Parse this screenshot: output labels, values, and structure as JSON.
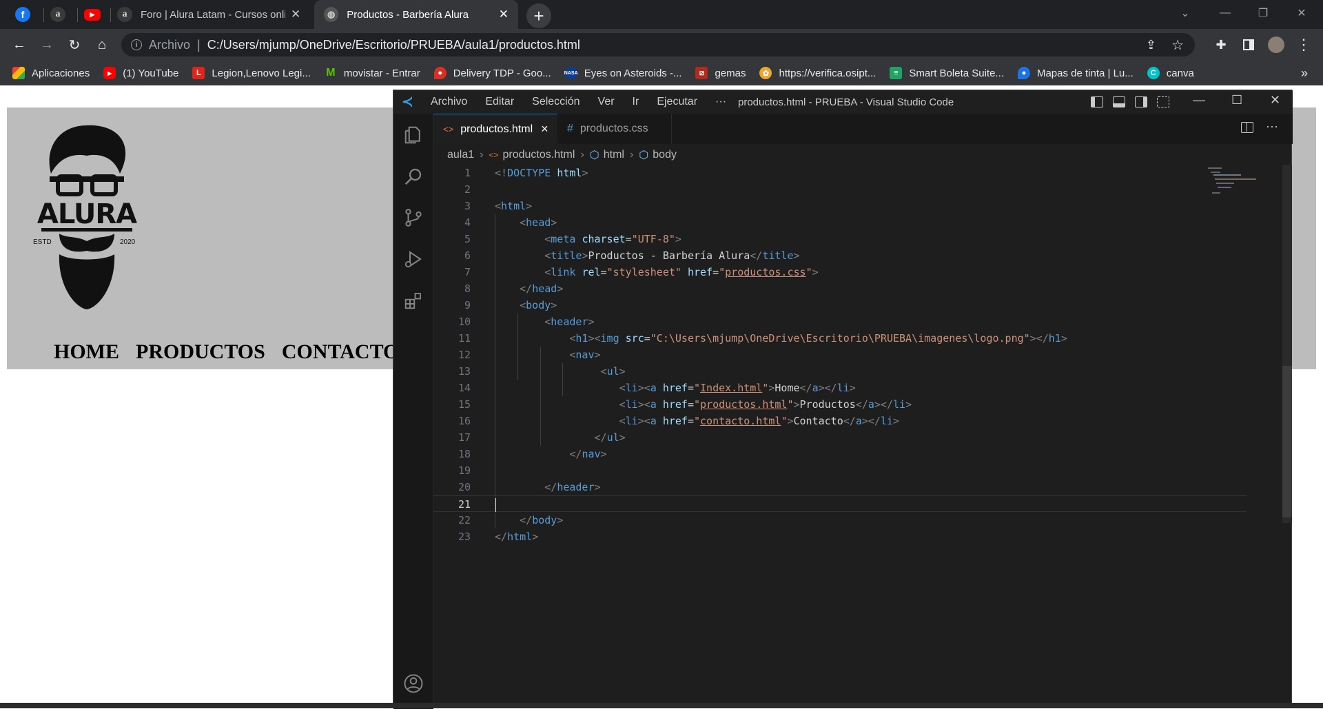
{
  "browser": {
    "tabs": [
      {
        "title": "",
        "icon": "facebook-icon"
      },
      {
        "title": "",
        "icon": "alura-icon"
      },
      {
        "title": "",
        "icon": "youtube-icon"
      },
      {
        "title": "Foro | Alura Latam - Cursos online",
        "icon": "alura-icon"
      },
      {
        "title": "Productos - Barbería Alura",
        "icon": "globe-icon",
        "active": true
      }
    ],
    "address": {
      "label": "Archivo",
      "url": "C:/Users/mjump/OneDrive/Escritorio/PRUEBA/aula1/productos.html"
    },
    "bookmarks": [
      {
        "label": "Aplicaciones",
        "icon": "apps-grid-icon"
      },
      {
        "label": "(1) YouTube",
        "icon": "youtube-icon"
      },
      {
        "label": "Legion,Lenovo Legi...",
        "icon": "lenovo-icon"
      },
      {
        "label": "movistar - Entrar",
        "icon": "movistar-icon"
      },
      {
        "label": "Delivery TDP - Goo...",
        "icon": "maps-pin-icon"
      },
      {
        "label": "Eyes on Asteroids -...",
        "icon": "nasa-icon"
      },
      {
        "label": "gemas",
        "icon": "dota-icon"
      },
      {
        "label": "https://verifica.osipt...",
        "icon": "osiptel-icon"
      },
      {
        "label": "Smart Boleta Suite...",
        "icon": "receipt-icon"
      },
      {
        "label": "Mapas de tinta | Lu...",
        "icon": "map-pin-icon"
      },
      {
        "label": "canva",
        "icon": "canva-icon"
      }
    ],
    "more_bookmarks": "»"
  },
  "site": {
    "logo": {
      "brand": "ALURA",
      "left": "ESTD",
      "right": "2020"
    },
    "nav": [
      "HOME",
      "PRODUCTOS",
      "CONTACTO"
    ]
  },
  "vscode": {
    "menu": [
      "Archivo",
      "Editar",
      "Selección",
      "Ver",
      "Ir",
      "Ejecutar",
      "···"
    ],
    "window_title": "productos.html - PRUEBA - Visual Studio Code",
    "tabs": [
      {
        "name": "productos.html",
        "icon": "<>",
        "active": true,
        "close": "×"
      },
      {
        "name": "productos.css",
        "icon": "#",
        "active": false
      }
    ],
    "breadcrumb": [
      "aula1",
      "productos.html",
      "html",
      "body"
    ],
    "code": [
      {
        "n": "1",
        "t": [
          [
            "p",
            "<!"
          ],
          [
            "tg",
            "DOCTYPE"
          ],
          [
            "tx",
            " "
          ],
          [
            "at",
            "html"
          ],
          [
            "p",
            ">"
          ]
        ]
      },
      {
        "n": "2",
        "t": []
      },
      {
        "n": "3",
        "t": [
          [
            "p",
            "<"
          ],
          [
            "tg",
            "html"
          ],
          [
            "p",
            ">"
          ]
        ]
      },
      {
        "n": "4",
        "t": [
          [
            "tx",
            "    "
          ],
          [
            "p",
            "<"
          ],
          [
            "tg",
            "head"
          ],
          [
            "p",
            ">"
          ]
        ]
      },
      {
        "n": "5",
        "t": [
          [
            "tx",
            "        "
          ],
          [
            "p",
            "<"
          ],
          [
            "tg",
            "meta"
          ],
          [
            "tx",
            " "
          ],
          [
            "at",
            "charset"
          ],
          [
            "tx",
            "="
          ],
          [
            "st",
            "\"UTF-8\""
          ],
          [
            "p",
            ">"
          ]
        ]
      },
      {
        "n": "6",
        "t": [
          [
            "tx",
            "        "
          ],
          [
            "p",
            "<"
          ],
          [
            "tg",
            "title"
          ],
          [
            "p",
            ">"
          ],
          [
            "tx",
            "Productos - Barbería Alura"
          ],
          [
            "p",
            "</"
          ],
          [
            "tg",
            "title"
          ],
          [
            "p",
            ">"
          ]
        ]
      },
      {
        "n": "7",
        "t": [
          [
            "tx",
            "        "
          ],
          [
            "p",
            "<"
          ],
          [
            "tg",
            "link"
          ],
          [
            "tx",
            " "
          ],
          [
            "at",
            "rel"
          ],
          [
            "tx",
            "="
          ],
          [
            "st",
            "\"stylesheet\""
          ],
          [
            "tx",
            " "
          ],
          [
            "at",
            "href"
          ],
          [
            "tx",
            "="
          ],
          [
            "st",
            "\""
          ],
          [
            "stu",
            "productos.css"
          ],
          [
            "st",
            "\""
          ],
          [
            "p",
            ">"
          ]
        ]
      },
      {
        "n": "8",
        "t": [
          [
            "tx",
            "    "
          ],
          [
            "p",
            "</"
          ],
          [
            "tg",
            "head"
          ],
          [
            "p",
            ">"
          ]
        ]
      },
      {
        "n": "9",
        "t": [
          [
            "tx",
            "    "
          ],
          [
            "p",
            "<"
          ],
          [
            "tg",
            "body"
          ],
          [
            "p",
            ">"
          ]
        ]
      },
      {
        "n": "10",
        "t": [
          [
            "tx",
            "        "
          ],
          [
            "p",
            "<"
          ],
          [
            "tg",
            "header"
          ],
          [
            "p",
            ">"
          ]
        ]
      },
      {
        "n": "11",
        "t": [
          [
            "tx",
            "            "
          ],
          [
            "p",
            "<"
          ],
          [
            "tg",
            "h1"
          ],
          [
            "p",
            "><"
          ],
          [
            "tg",
            "img"
          ],
          [
            "tx",
            " "
          ],
          [
            "at",
            "src"
          ],
          [
            "tx",
            "="
          ],
          [
            "st",
            "\"C:\\Users\\mjump\\OneDrive\\Escritorio\\PRUEBA\\imagenes\\logo.png\""
          ],
          [
            "p",
            "></"
          ],
          [
            "tg",
            "h1"
          ],
          [
            "p",
            ">"
          ]
        ]
      },
      {
        "n": "12",
        "t": [
          [
            "tx",
            "            "
          ],
          [
            "p",
            "<"
          ],
          [
            "tg",
            "nav"
          ],
          [
            "p",
            ">"
          ]
        ]
      },
      {
        "n": "13",
        "t": [
          [
            "tx",
            "                 "
          ],
          [
            "p",
            "<"
          ],
          [
            "tg",
            "ul"
          ],
          [
            "p",
            ">"
          ]
        ]
      },
      {
        "n": "14",
        "t": [
          [
            "tx",
            "                    "
          ],
          [
            "p",
            "<"
          ],
          [
            "tg",
            "li"
          ],
          [
            "p",
            "><"
          ],
          [
            "tg",
            "a"
          ],
          [
            "tx",
            " "
          ],
          [
            "at",
            "href"
          ],
          [
            "tx",
            "="
          ],
          [
            "st",
            "\""
          ],
          [
            "stu",
            "Index.html"
          ],
          [
            "st",
            "\""
          ],
          [
            "p",
            ">"
          ],
          [
            "tx",
            "Home"
          ],
          [
            "p",
            "</"
          ],
          [
            "tg",
            "a"
          ],
          [
            "p",
            "></"
          ],
          [
            "tg",
            "li"
          ],
          [
            "p",
            ">"
          ]
        ]
      },
      {
        "n": "15",
        "t": [
          [
            "tx",
            "                    "
          ],
          [
            "p",
            "<"
          ],
          [
            "tg",
            "li"
          ],
          [
            "p",
            "><"
          ],
          [
            "tg",
            "a"
          ],
          [
            "tx",
            " "
          ],
          [
            "at",
            "href"
          ],
          [
            "tx",
            "="
          ],
          [
            "st",
            "\""
          ],
          [
            "stu",
            "productos.html"
          ],
          [
            "st",
            "\""
          ],
          [
            "p",
            ">"
          ],
          [
            "tx",
            "Productos"
          ],
          [
            "p",
            "</"
          ],
          [
            "tg",
            "a"
          ],
          [
            "p",
            "></"
          ],
          [
            "tg",
            "li"
          ],
          [
            "p",
            ">"
          ]
        ]
      },
      {
        "n": "16",
        "t": [
          [
            "tx",
            "                    "
          ],
          [
            "p",
            "<"
          ],
          [
            "tg",
            "li"
          ],
          [
            "p",
            "><"
          ],
          [
            "tg",
            "a"
          ],
          [
            "tx",
            " "
          ],
          [
            "at",
            "href"
          ],
          [
            "tx",
            "="
          ],
          [
            "st",
            "\""
          ],
          [
            "stu",
            "contacto.html"
          ],
          [
            "st",
            "\""
          ],
          [
            "p",
            ">"
          ],
          [
            "tx",
            "Contacto"
          ],
          [
            "p",
            "</"
          ],
          [
            "tg",
            "a"
          ],
          [
            "p",
            "></"
          ],
          [
            "tg",
            "li"
          ],
          [
            "p",
            ">"
          ]
        ]
      },
      {
        "n": "17",
        "t": [
          [
            "tx",
            "                "
          ],
          [
            "p",
            "</"
          ],
          [
            "tg",
            "ul"
          ],
          [
            "p",
            ">"
          ]
        ]
      },
      {
        "n": "18",
        "t": [
          [
            "tx",
            "            "
          ],
          [
            "p",
            "</"
          ],
          [
            "tg",
            "nav"
          ],
          [
            "p",
            ">"
          ]
        ]
      },
      {
        "n": "19",
        "t": []
      },
      {
        "n": "20",
        "t": [
          [
            "tx",
            "        "
          ],
          [
            "p",
            "</"
          ],
          [
            "tg",
            "header"
          ],
          [
            "p",
            ">"
          ]
        ]
      },
      {
        "n": "21",
        "t": [],
        "current": true
      },
      {
        "n": "22",
        "t": [
          [
            "tx",
            "    "
          ],
          [
            "p",
            "</"
          ],
          [
            "tg",
            "body"
          ],
          [
            "p",
            ">"
          ]
        ]
      },
      {
        "n": "23",
        "t": [
          [
            "p",
            "</"
          ],
          [
            "tg",
            "html"
          ],
          [
            "p",
            ">"
          ]
        ]
      }
    ]
  },
  "colors": {
    "tag": "#569cd6",
    "attr": "#9cdcfe",
    "string": "#ce9178",
    "punct": "#808080",
    "text": "#d4d4d4",
    "editor_bg": "#1e1e1e"
  }
}
